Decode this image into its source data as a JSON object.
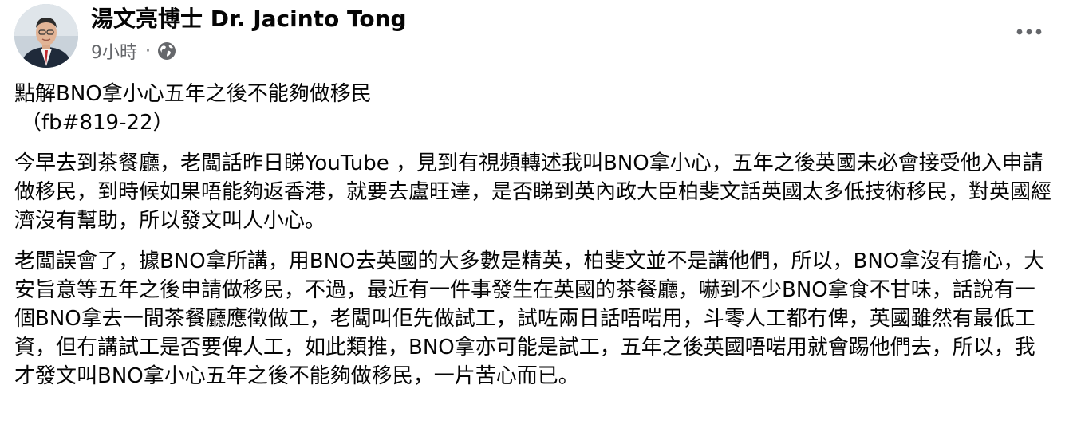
{
  "author": {
    "name": "湯文亮博士 Dr. Jacinto Tong",
    "timestamp": "9小時",
    "separator": "·",
    "audience_icon": "globe-icon"
  },
  "menu": {
    "more_icon": "more-options-icon"
  },
  "post": {
    "title": "點解BNO拿小心五年之後不能夠做移民",
    "tag": "（fb#819-22）",
    "paragraphs": [
      "今早去到茶餐廳，老闆話昨日睇YouTube ，見到有視頻轉述我叫BNO拿小心，五年之後英國未必會接受他入申請做移民，到時候如果唔能夠返香港，就要去盧旺達，是否睇到英內政大臣柏斐文話英國太多低技術移民，對英國經濟沒有幫助，所以發文叫人小心。",
      "老闆誤會了，據BNO拿所講，用BNO去英國的大多數是精英，柏斐文並不是講他們，所以，BNO拿沒有擔心，大安旨意等五年之後申請做移民，不過，最近有一件事發生在英國的茶餐廳，嚇到不少BNO拿食不甘味，話說有一個BNO拿去一間茶餐廳應徵做工，老闆叫佢先做試工，試咗兩日話唔啱用，斗零人工都冇俾，英國雖然有最低工資，但冇講試工是否要俾人工，如此類推，BNO拿亦可能是試工，五年之後英國唔啱用就會踢他們去，所以，我才發文叫BNO拿小心五年之後不能夠做移民，一片苦心而已。"
    ]
  },
  "colors": {
    "text": "#050505",
    "secondary": "#65676b",
    "background": "#ffffff"
  }
}
